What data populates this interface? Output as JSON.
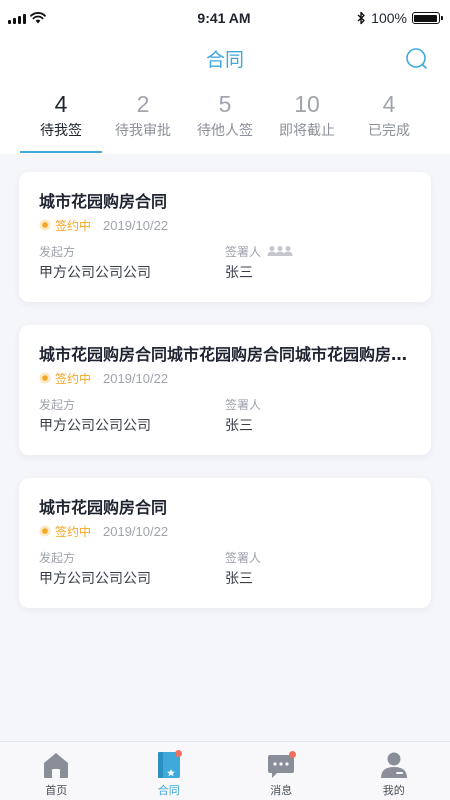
{
  "status_bar": {
    "time": "9:41 AM",
    "battery": "100%",
    "battery_level": 1.0
  },
  "header": {
    "title": "合同"
  },
  "tabs": [
    {
      "count": "4",
      "label": "待我签",
      "active": true
    },
    {
      "count": "2",
      "label": "待我审批",
      "active": false
    },
    {
      "count": "5",
      "label": "待他人签",
      "active": false
    },
    {
      "count": "10",
      "label": "即将截止",
      "active": false
    },
    {
      "count": "4",
      "label": "已完成",
      "active": false
    }
  ],
  "contracts": [
    {
      "title": "城市花园购房合同",
      "status": "签约中",
      "date": "2019/10/22",
      "initiator_label": "发起方",
      "initiator": "甲方公司公司公司",
      "signer_label": "签署人",
      "signer": "张三"
    },
    {
      "title": "城市花园购房合同城市花园购房合同城市花园购房合同",
      "status": "签约中",
      "date": "2019/10/22",
      "initiator_label": "发起方",
      "initiator": "甲方公司公司公司",
      "signer_label": "签署人",
      "signer": "张三"
    },
    {
      "title": "城市花园购房合同",
      "status": "签约中",
      "date": "2019/10/22",
      "initiator_label": "发起方",
      "initiator": "甲方公司公司公司",
      "signer_label": "签署人",
      "signer": "张三"
    }
  ],
  "bottom_nav": [
    {
      "label": "首页",
      "icon": "home-icon"
    },
    {
      "label": "合同",
      "icon": "contract-icon"
    },
    {
      "label": "消息",
      "icon": "message-icon"
    },
    {
      "label": "我的",
      "icon": "profile-icon"
    }
  ],
  "colors": {
    "accent": "#3fa9d9",
    "status_pending": "#f5a623",
    "badge": "#f36e5f"
  }
}
